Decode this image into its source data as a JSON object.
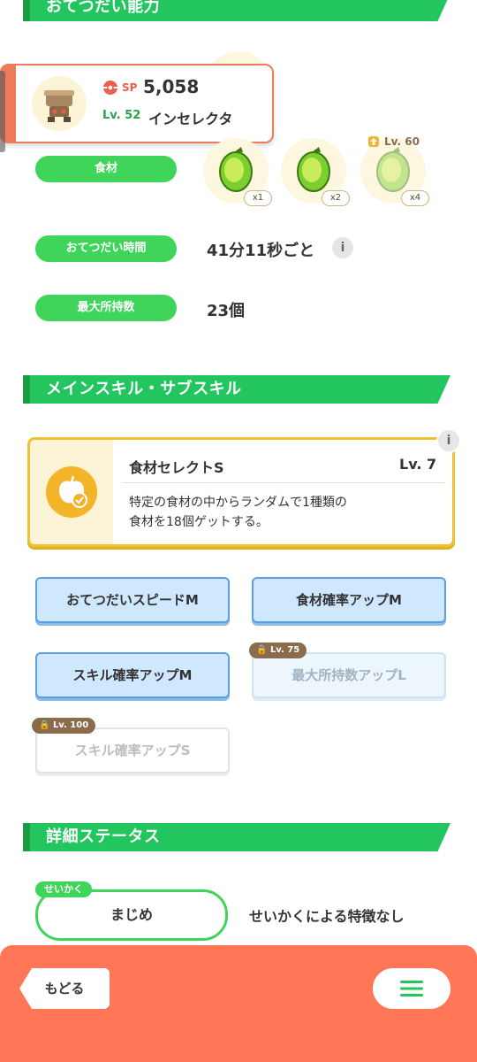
{
  "sections": {
    "help_ability": "おてつだい能力",
    "skills": "メインスキル・サブスキル",
    "details": "詳細ステータス"
  },
  "pokemon": {
    "sp_label": "SP",
    "sp_value": "5,058",
    "level": "Lv. 52",
    "name": "インセレクタ"
  },
  "help": {
    "ingredient_label": "食材",
    "ingredients": [
      {
        "count": "x1",
        "icon": "lime-icon",
        "locked": false
      },
      {
        "count": "x2",
        "icon": "lime-icon",
        "locked": false
      },
      {
        "count": "x4",
        "icon": "lime-icon",
        "locked": true,
        "unlock_level": "Lv. 60"
      }
    ],
    "time_label": "おてつだい時間",
    "time_value": "41分11秒ごと",
    "max_label": "最大所持数",
    "max_value": "23個"
  },
  "main_skill": {
    "name": "食材セレクトS",
    "level": "Lv. 7",
    "description_line1": "特定の食材の中からランダムで1種類の",
    "description_line2": "食材を18個ゲットする。"
  },
  "sub_skills": [
    {
      "label": "おてつだいスピードM",
      "locked": false
    },
    {
      "label": "食材確率アップM",
      "locked": false
    },
    {
      "label": "スキル確率アップM",
      "locked": false
    },
    {
      "label": "最大所持数アップL",
      "locked": true,
      "unlock_level": "Lv. 75"
    },
    {
      "label": "スキル確率アップS",
      "locked": true,
      "unlock_level": "Lv. 100"
    }
  ],
  "nature": {
    "tag": "せいかく",
    "value": "まじめ",
    "effect": "せいかくによる特徴なし"
  },
  "bottom": {
    "back_label": "もどる"
  },
  "colors": {
    "green": "#22c55e",
    "pill_green": "#3fd45a",
    "accent_red": "#f07b5c",
    "bottom_bar": "#ff7757",
    "skill_gold": "#f0c030"
  }
}
